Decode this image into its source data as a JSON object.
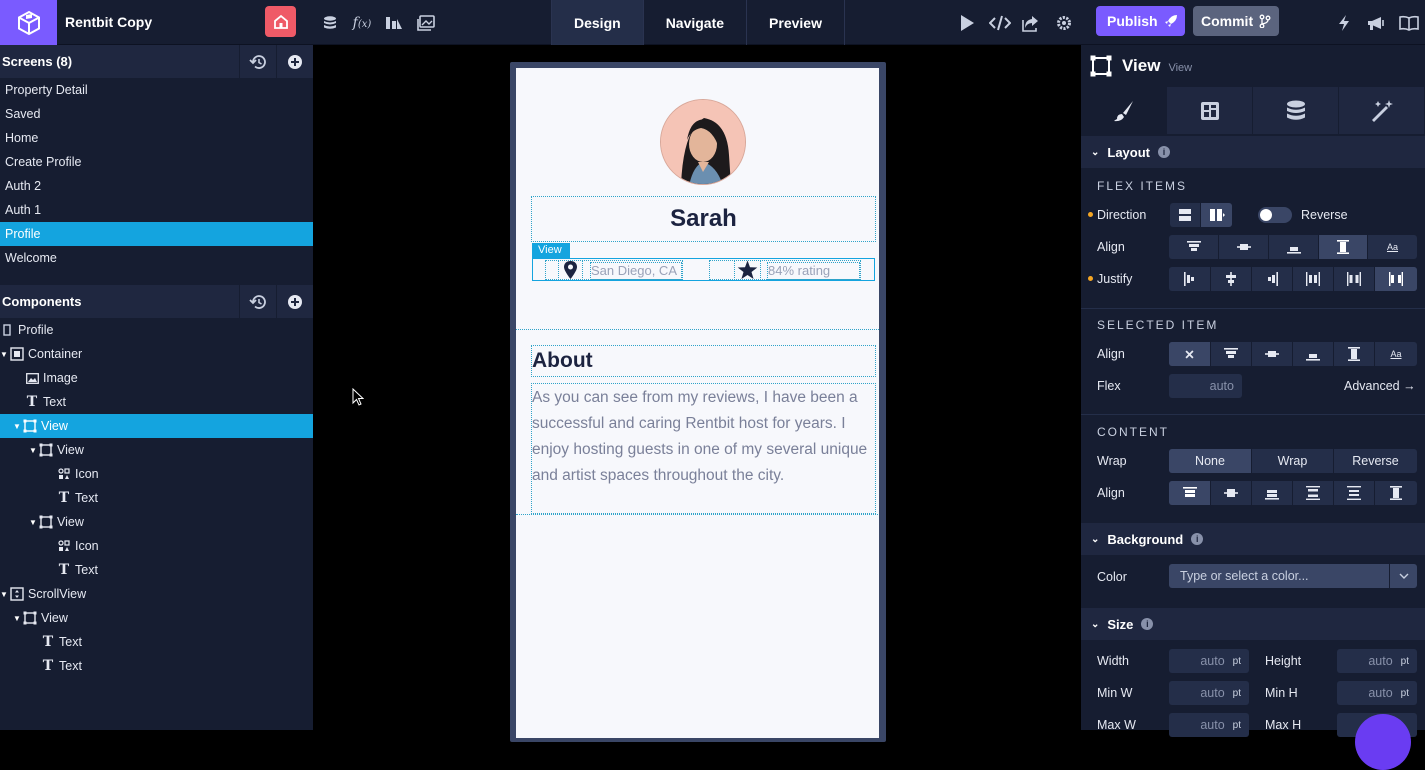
{
  "app": {
    "title": "Rentbit Copy"
  },
  "toolbar": {
    "modes": [
      "Design",
      "Navigate",
      "Preview"
    ],
    "active_mode": "Design",
    "publish_label": "Publish",
    "commit_label": "Commit"
  },
  "screens": {
    "header": "Screens (8)",
    "items": [
      "Property Detail",
      "Saved",
      "Home",
      "Create Profile",
      "Auth 2",
      "Auth 1",
      "Profile",
      "Welcome"
    ],
    "selected": "Profile"
  },
  "components": {
    "header": "Components",
    "tree": [
      {
        "label": "Profile",
        "icon": "screen-icon"
      },
      {
        "label": "Container",
        "icon": "container-icon"
      },
      {
        "label": "Image",
        "icon": "image-icon"
      },
      {
        "label": "Text",
        "icon": "text-icon"
      },
      {
        "label": "View",
        "icon": "view-icon"
      },
      {
        "label": "View",
        "icon": "view-icon"
      },
      {
        "label": "Icon",
        "icon": "icon-component-icon"
      },
      {
        "label": "Text",
        "icon": "text-icon"
      },
      {
        "label": "View",
        "icon": "view-icon"
      },
      {
        "label": "Icon",
        "icon": "icon-component-icon"
      },
      {
        "label": "Text",
        "icon": "text-icon"
      },
      {
        "label": "ScrollView",
        "icon": "scrollview-icon"
      },
      {
        "label": "View",
        "icon": "view-icon"
      },
      {
        "label": "Text",
        "icon": "text-icon"
      },
      {
        "label": "Text",
        "icon": "text-icon"
      }
    ]
  },
  "preview": {
    "name": "Sarah",
    "selection_tag": "View",
    "location": "San Diego, CA",
    "rating": "84% rating",
    "about_title": "About",
    "about_body": "As you can see from my reviews, I have been a successful and caring Rentbit host for years. I enjoy hosting guests in one of my several unique and artist spaces throughout the city."
  },
  "inspector": {
    "title": "View",
    "subtitle": "View",
    "layout": {
      "header": "Layout",
      "flex_items": "FLEX ITEMS",
      "direction_label": "Direction",
      "reverse_label": "Reverse",
      "align_label": "Align",
      "justify_label": "Justify",
      "selected_item": "SELECTED ITEM",
      "selected_align_label": "Align",
      "flex_label": "Flex",
      "flex_value": "auto",
      "advanced_label": "Advanced →",
      "content": "CONTENT",
      "wrap_label": "Wrap",
      "wrap_options": [
        "None",
        "Wrap",
        "Reverse"
      ],
      "wrap_selected": "None",
      "content_align_label": "Align"
    },
    "background": {
      "header": "Background",
      "color_label": "Color",
      "color_placeholder": "Type or select a color..."
    },
    "size": {
      "header": "Size",
      "width_label": "Width",
      "width_value": "auto",
      "height_label": "Height",
      "height_value": "auto",
      "minw_label": "Min W",
      "minw_value": "auto",
      "minh_label": "Min H",
      "minh_value": "auto",
      "maxw_label": "Max W",
      "maxw_value": "auto",
      "maxh_label": "Max H",
      "unit": "pt"
    }
  }
}
